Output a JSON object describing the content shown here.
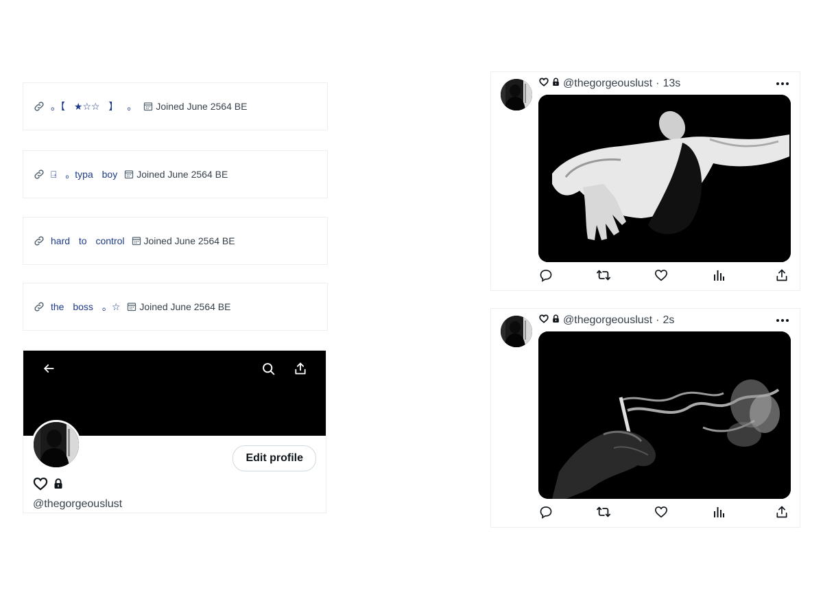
{
  "profile_info_rows": [
    {
      "link_text": "。【 ★☆☆ 】 。",
      "joined": "Joined June 2564 BE"
    },
    {
      "link_text": "⍈ 。typa boy",
      "joined": "Joined June 2564 BE"
    },
    {
      "link_text": "hard to control",
      "joined": "Joined June 2564 BE"
    },
    {
      "link_text": "the boss 。☆",
      "joined": "Joined June 2564 BE"
    }
  ],
  "profile": {
    "edit_button": "Edit profile",
    "handle": "@thegorgeouslust"
  },
  "tweets": [
    {
      "handle": "@thegorgeouslust",
      "separator": "·",
      "time": "13s",
      "media_desc": "man in white shirt lying back"
    },
    {
      "handle": "@thegorgeouslust",
      "separator": "·",
      "time": "2s",
      "media_desc": "hand holding cigarette with smoke"
    }
  ],
  "icons": {
    "link": "link-icon",
    "calendar": "calendar-icon",
    "back": "arrow-left-icon",
    "search": "search-icon",
    "share": "share-icon",
    "heart": "heart-icon",
    "lock": "lock-icon",
    "more": "more-icon",
    "reply": "reply-icon",
    "retweet": "retweet-icon",
    "like": "like-icon",
    "views": "views-icon"
  },
  "colors": {
    "link_text": "#1d3a8a",
    "border": "#eceef0",
    "banner": "#000000"
  }
}
